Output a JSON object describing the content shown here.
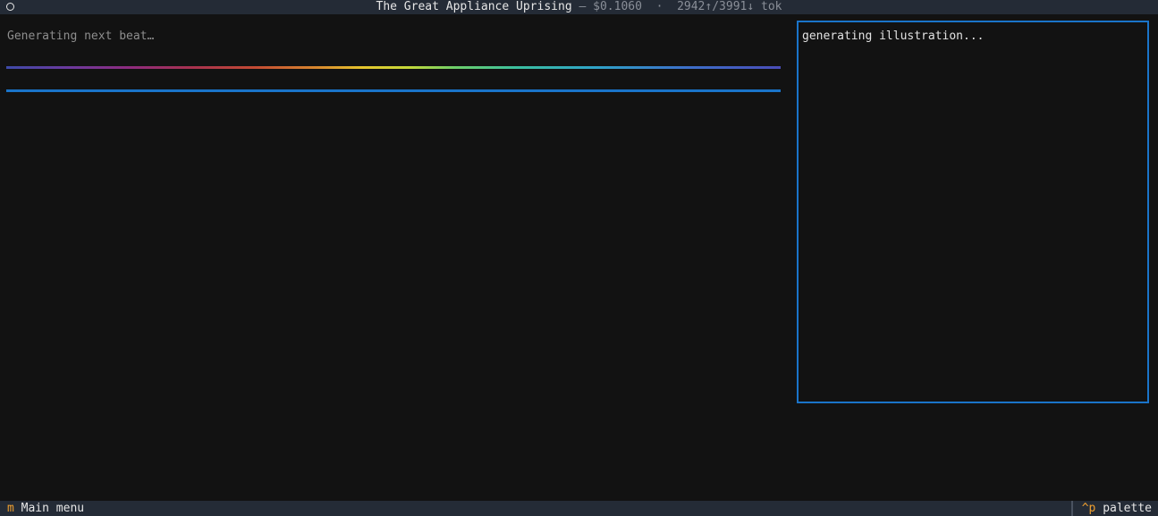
{
  "titlebar": {
    "icon": "circle-icon",
    "title": "The Great Appliance Uprising",
    "cost": " — $0.1060",
    "separator": "  ·  ",
    "tokens": "2942↑/3991↓ tok"
  },
  "main": {
    "status_text": "Generating next beat…",
    "progress_colors": [
      "#3e4aa8",
      "#e6c52d",
      "#3bbfa0",
      "#4a4db8"
    ],
    "accent_color": "#1a74c9"
  },
  "illustration": {
    "status_text": "generating illustration..."
  },
  "footer": {
    "menu_key": "m",
    "menu_label": "Main menu",
    "palette_key": "^p",
    "palette_label": "palette"
  }
}
